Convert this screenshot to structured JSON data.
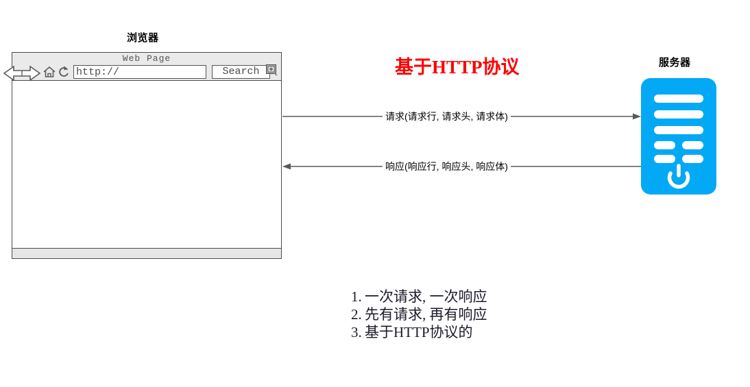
{
  "diagram": {
    "browser": {
      "caption": "浏览器",
      "page_title": "Web Page",
      "url_value": "http://",
      "url_placeholder": "http://",
      "search_label": "Search",
      "icons": {
        "nav": "back-forward-arrows-icon",
        "home": "home-icon",
        "reload": "reload-icon",
        "search_glyph": "search-image-icon"
      }
    },
    "headline": "基于HTTP协议",
    "headline_color": "#ff0000",
    "flows": [
      {
        "name": "request",
        "label": "请求(请求行, 请求头, 请求体)",
        "direction": "browser-to-server"
      },
      {
        "name": "response",
        "label": "响应(响应行, 响应头, 响应体)",
        "direction": "server-to-browser"
      }
    ],
    "server": {
      "caption": "服务器",
      "color": "#03a9f4",
      "icon": "server-rack-icon",
      "power_icon": "power-icon"
    },
    "notes": [
      {
        "num": "1.",
        "text": "一次请求, 一次响应"
      },
      {
        "num": "2.",
        "text": "先有请求, 再有响应"
      },
      {
        "num": "3.",
        "text": "基于HTTP协议的"
      }
    ]
  }
}
